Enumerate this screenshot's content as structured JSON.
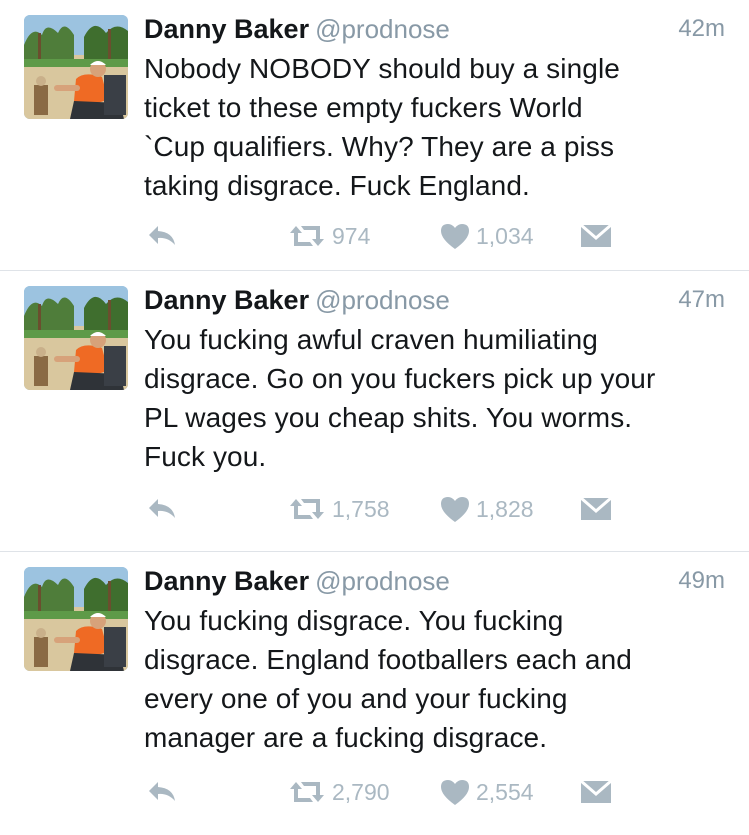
{
  "tweets": [
    {
      "name": "Danny Baker",
      "handle": "@prodnose",
      "time": "42m",
      "text": "Nobody NOBODY should buy a single\nticket to these empty fuckers World\n`Cup qualifiers. Why? They are a piss\ntaking disgrace. Fuck England.",
      "retweets": "974",
      "likes": "1,034"
    },
    {
      "name": "Danny Baker",
      "handle": "@prodnose",
      "time": "47m",
      "text": "You fucking awful craven humiliating\ndisgrace. Go on you fuckers pick up your\nPL wages you cheap shits. You worms.\nFuck you.",
      "retweets": "1,758",
      "likes": "1,828"
    },
    {
      "name": "Danny Baker",
      "handle": "@prodnose",
      "time": "49m",
      "text": "You fucking disgrace. You fucking\ndisgrace. England footballers each and\nevery one of you and your fucking\nmanager are a fucking disgrace.",
      "retweets": "2,790",
      "likes": "2,554"
    }
  ],
  "icons": {
    "reply": "reply-icon",
    "retweet": "retweet-icon",
    "like": "heart-icon",
    "dm": "envelope-icon"
  },
  "colors": {
    "text": "#14171a",
    "muted": "#8899a6",
    "action": "#aab8c2",
    "divider": "#dfe3e8"
  }
}
